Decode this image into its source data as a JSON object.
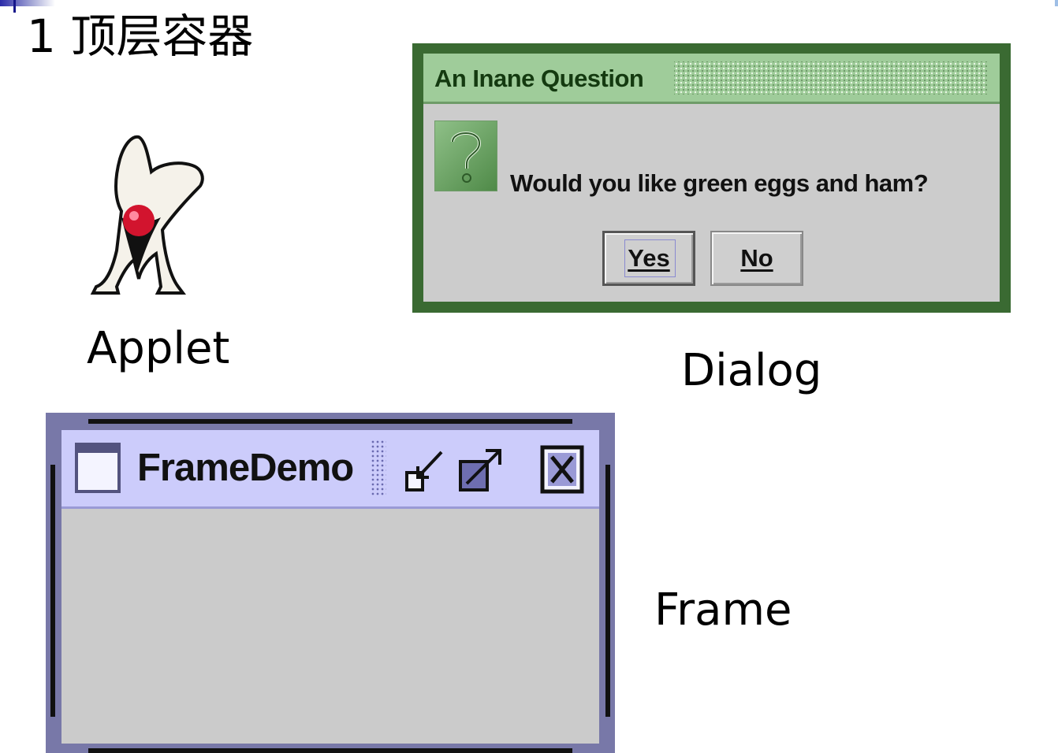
{
  "slide": {
    "title": "1 顶层容器",
    "captions": {
      "applet": "Applet",
      "dialog": "Dialog",
      "frame": "Frame"
    }
  },
  "dialog": {
    "title": "An Inane Question",
    "message": "Would you like green eggs and ham?",
    "buttons": {
      "yes": "Yes",
      "no": "No"
    },
    "icon": "question-icon"
  },
  "frame": {
    "title": "FrameDemo",
    "controls": [
      "minimize-icon",
      "maximize-icon",
      "close-icon"
    ]
  },
  "colors": {
    "dialog_border": "#3a6a32",
    "dialog_titlebar": "#9fcc9a",
    "dialog_body": "#cccccc",
    "frame_border": "#7878a8",
    "frame_titlebar": "#ccccfb",
    "frame_body": "#cbcbcb"
  }
}
